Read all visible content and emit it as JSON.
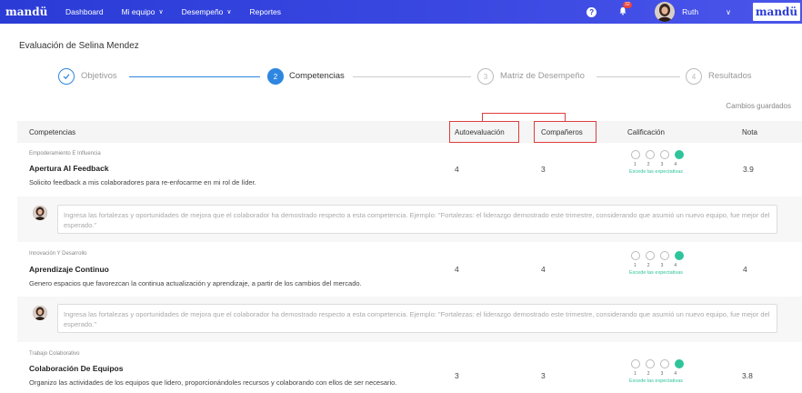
{
  "nav": {
    "logo": "mandü",
    "items": [
      {
        "label": "Dashboard",
        "has_dropdown": false
      },
      {
        "label": "Mi equipo",
        "has_dropdown": true
      },
      {
        "label": "Desempeño",
        "has_dropdown": true
      },
      {
        "label": "Reportes",
        "has_dropdown": false
      }
    ],
    "notification_count": "32",
    "user_name": "Ruth",
    "brand": "mandü"
  },
  "page": {
    "title": "Evaluación de Selina Mendez",
    "saved_status": "Cambios guardados"
  },
  "stepper": {
    "steps": [
      {
        "number": "✓",
        "label": "Objetivos",
        "state": "done"
      },
      {
        "number": "2",
        "label": "Competencias",
        "state": "active"
      },
      {
        "number": "3",
        "label": "Matriz de Desempeño",
        "state": "pending"
      },
      {
        "number": "4",
        "label": "Resultados",
        "state": "pending"
      }
    ]
  },
  "table": {
    "headers": {
      "competencias": "Competencias",
      "autoevaluacion": "Autoevaluación",
      "companeros": "Compañeros",
      "calificacion": "Calificación",
      "nota": "Nota"
    },
    "scale": [
      "1",
      "2",
      "3",
      "4"
    ],
    "rows": [
      {
        "category": "Empoderamiento E Influencia",
        "title": "Apertura Al Feedback",
        "description": "Solicito feedback a mis colaboradores para re-enfocarme en mi rol de líder.",
        "autoevaluacion": "4",
        "companeros": "3",
        "rating": 4,
        "rating_label": "Excede las expectativas",
        "nota": "3.9"
      },
      {
        "category": "Innovación Y Desarrollo",
        "title": "Aprendizaje Continuo",
        "description": "Genero espacios que favorezcan la continua actualización y aprendizaje, a partir de los cambios del mercado.",
        "autoevaluacion": "4",
        "companeros": "4",
        "rating": 4,
        "rating_label": "Excede las expectativas",
        "nota": "4"
      },
      {
        "category": "Trabajo Colaborativo",
        "title": "Colaboración De Equipos",
        "description": "Organizo las actividades de los equipos que lidero, proporcionándoles recursos y colaborando con ellos de ser necesario.",
        "autoevaluacion": "3",
        "companeros": "3",
        "rating": 4,
        "rating_label": "Excede las expectativas",
        "nota": "3.8"
      }
    ]
  },
  "comment": {
    "placeholder": "Ingresa las fortalezas y oportunidades de mejora que el colaborador ha demostrado respecto a esta competencia. Ejemplo: \"Fortalezas: el liderazgo demostrado este trimestre, considerando que asumió un nuevo equipo, fue mejor del esperado.\""
  },
  "colors": {
    "nav": "#2a3bd6",
    "accent": "#2e86e0",
    "rating_selected": "#2fc49a",
    "highlight_box": "#e03c3c"
  }
}
